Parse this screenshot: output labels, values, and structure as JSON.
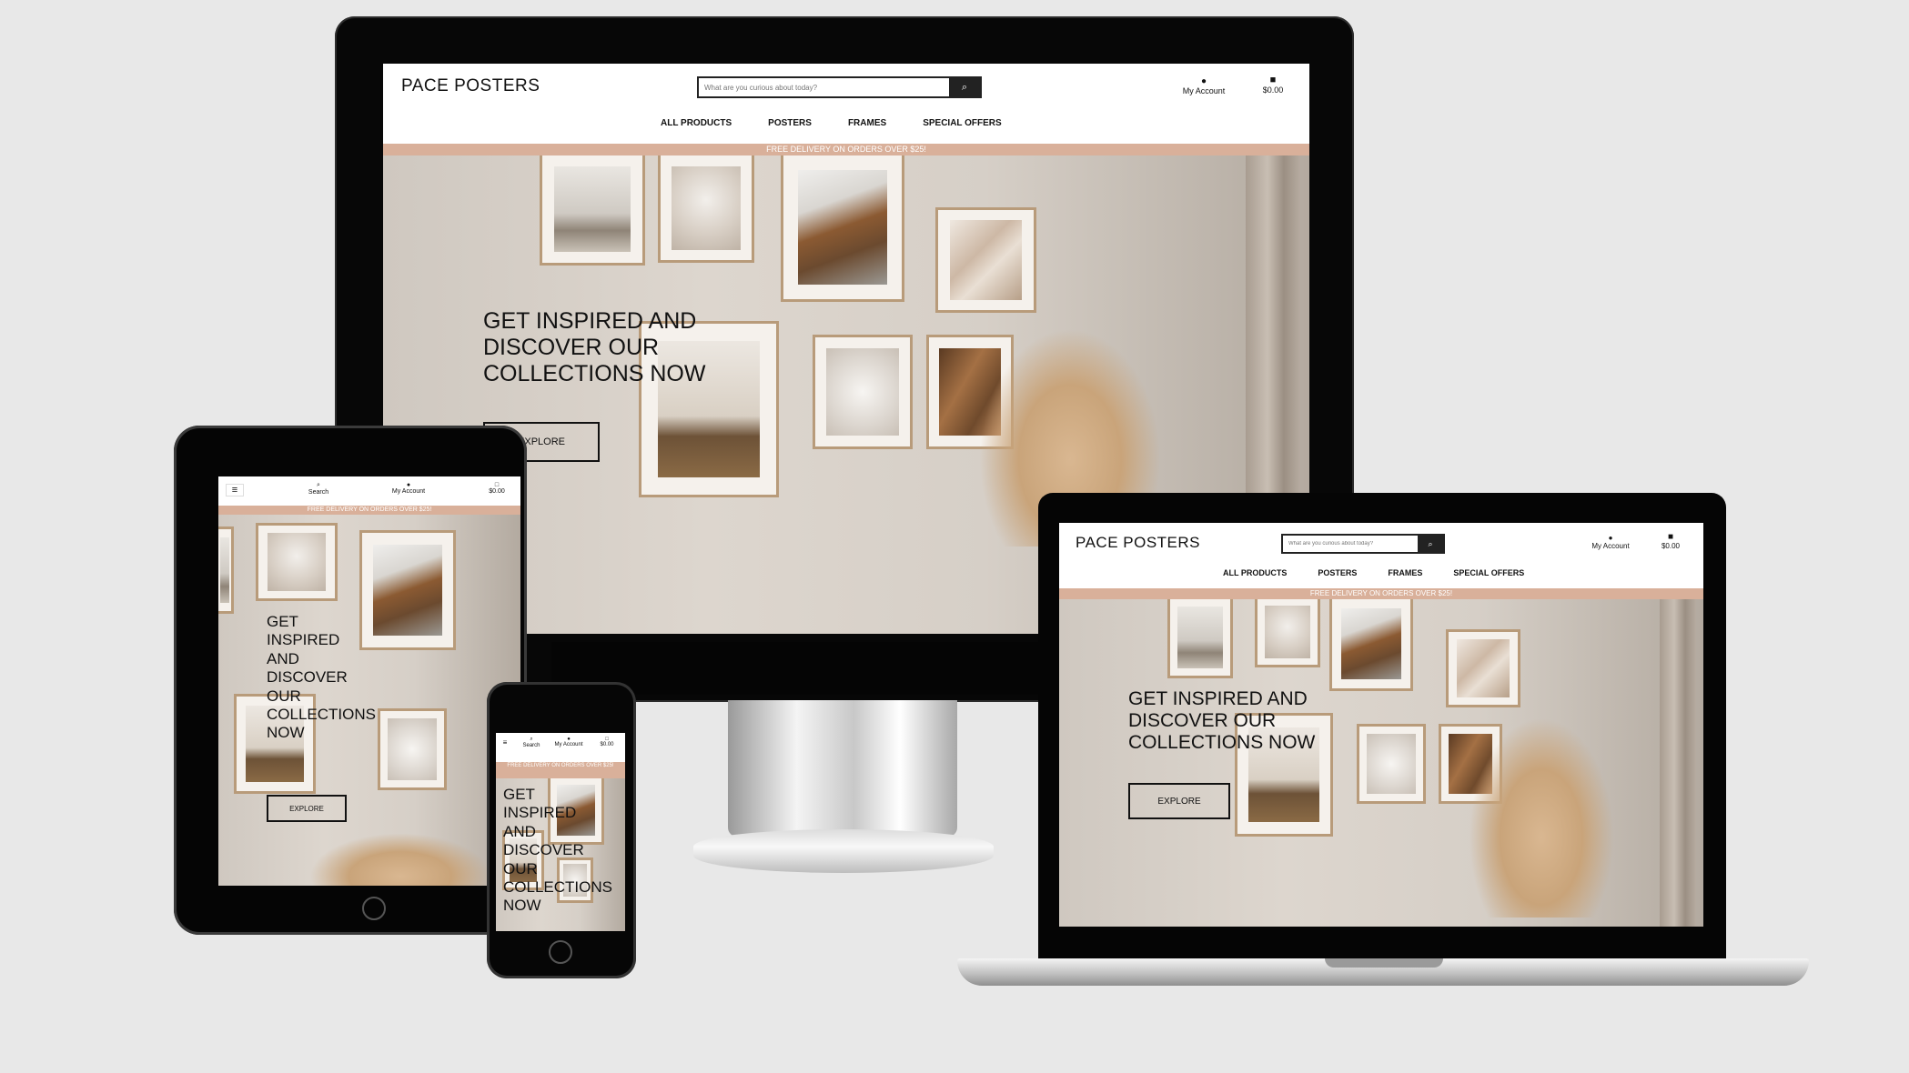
{
  "site": {
    "logo": "PACE POSTERS",
    "search_placeholder": "What are you curious about today?",
    "search_label": "Search",
    "account_label": "My Account",
    "cart_total": "$0.00",
    "nav": [
      "ALL PRODUCTS",
      "POSTERS",
      "FRAMES",
      "SPECIAL OFFERS"
    ],
    "banner": "FREE DELIVERY ON ORDERS OVER $25!",
    "hero_line1": "GET INSPIRED AND",
    "hero_line2": "DISCOVER OUR",
    "hero_line3": "COLLECTIONS NOW",
    "mobile_hero": [
      "GET",
      "INSPIRED",
      "AND",
      "DISCOVER",
      "OUR",
      "COLLECTIONS",
      "NOW"
    ],
    "explore": "EXPLORE"
  },
  "icons": {
    "account": "person-icon",
    "cart": "shopping-bag-icon",
    "search": "magnifier-icon",
    "menu": "hamburger-icon"
  },
  "colors": {
    "banner": "#d9b09a",
    "background": "#e8e8e8",
    "device": "#050505"
  }
}
